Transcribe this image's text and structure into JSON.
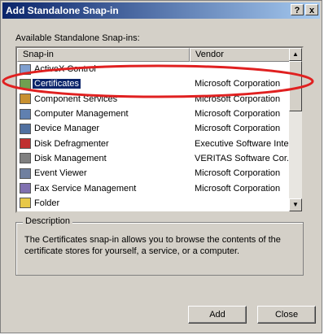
{
  "window": {
    "title": "Add Standalone Snap-in",
    "help_btn": "?",
    "close_btn": "x"
  },
  "list_label": "Available Standalone Snap-ins:",
  "columns": {
    "snapin": "Snap-in",
    "vendor": "Vendor"
  },
  "items": [
    {
      "name": "ActiveX Control",
      "vendor": "",
      "icon": "activex-control-icon",
      "color": "#7f9fcf"
    },
    {
      "name": "Certificates",
      "vendor": "Microsoft Corporation",
      "icon": "certificates-icon",
      "color": "#6fa050",
      "selected": true
    },
    {
      "name": "Component Services",
      "vendor": "Microsoft Corporation",
      "icon": "component-services-icon",
      "color": "#c89030"
    },
    {
      "name": "Computer Management",
      "vendor": "Microsoft Corporation",
      "icon": "computer-management-icon",
      "color": "#6080b0"
    },
    {
      "name": "Device Manager",
      "vendor": "Microsoft Corporation",
      "icon": "device-manager-icon",
      "color": "#5070a0"
    },
    {
      "name": "Disk Defragmenter",
      "vendor": "Executive Software Inte...",
      "icon": "disk-defragmenter-icon",
      "color": "#c03030"
    },
    {
      "name": "Disk Management",
      "vendor": "VERITAS Software Cor...",
      "icon": "disk-management-icon",
      "color": "#808080"
    },
    {
      "name": "Event Viewer",
      "vendor": "Microsoft Corporation",
      "icon": "event-viewer-icon",
      "color": "#7080a0"
    },
    {
      "name": "Fax Service Management",
      "vendor": "Microsoft Corporation",
      "icon": "fax-service-icon",
      "color": "#8070b0"
    },
    {
      "name": "Folder",
      "vendor": "",
      "icon": "folder-icon",
      "color": "#e8c848"
    }
  ],
  "description": {
    "legend": "Description",
    "text": "The Certificates snap-in allows you to browse the contents of the certificate stores for yourself, a service, or a computer."
  },
  "buttons": {
    "add": "Add",
    "close": "Close"
  },
  "colors": {
    "titlebar_start": "#0a246a",
    "selection": "#0a246a",
    "annotation": "#e02020"
  }
}
